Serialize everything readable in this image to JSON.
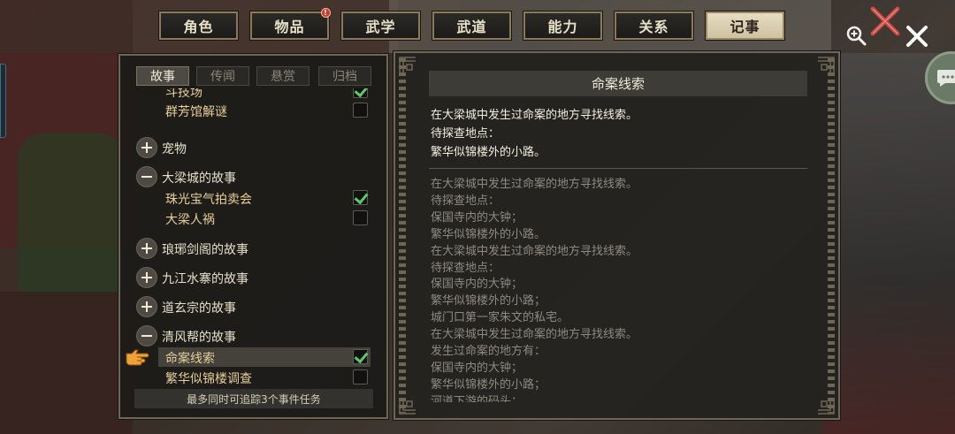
{
  "tabs": [
    {
      "label": "角色",
      "active": false
    },
    {
      "label": "物品",
      "active": false,
      "badge": "!"
    },
    {
      "label": "武学",
      "active": false
    },
    {
      "label": "武道",
      "active": false
    },
    {
      "label": "能力",
      "active": false
    },
    {
      "label": "关系",
      "active": false
    },
    {
      "label": "记事",
      "active": true
    }
  ],
  "subtabs": [
    {
      "label": "故事",
      "active": true
    },
    {
      "label": "传闻",
      "active": false
    },
    {
      "label": "悬赏",
      "active": false
    },
    {
      "label": "归档",
      "active": false
    }
  ],
  "list": {
    "items": [
      {
        "kind": "sub",
        "label": "斗技场",
        "checked": true
      },
      {
        "kind": "sub",
        "label": "群芳馆解谜",
        "checked": false
      },
      {
        "kind": "group",
        "label": "宠物",
        "expanded": false
      },
      {
        "kind": "group",
        "label": "大梁城的故事",
        "expanded": true
      },
      {
        "kind": "sub",
        "label": "珠光宝气拍卖会",
        "checked": true
      },
      {
        "kind": "sub",
        "label": "大梁人祸",
        "checked": false
      },
      {
        "kind": "group",
        "label": "琅琊剑阁的故事",
        "expanded": false
      },
      {
        "kind": "group",
        "label": "九江水寨的故事",
        "expanded": false
      },
      {
        "kind": "group",
        "label": "道玄宗的故事",
        "expanded": false
      },
      {
        "kind": "group",
        "label": "清风帮的故事",
        "expanded": true
      },
      {
        "kind": "sub",
        "label": "命案线索",
        "checked": true,
        "selected": true
      },
      {
        "kind": "sub",
        "label": "繁华似锦楼调查",
        "checked": false
      }
    ]
  },
  "footer": "最多同时可追踪3个事件任务",
  "detail": {
    "title": "命案线索",
    "current": [
      "在大梁城中发生过命案的地方寻找线索。",
      "待探查地点：",
      "繁华似锦楼外的小路。"
    ],
    "history": [
      "在大梁城中发生过命案的地方寻找线索。",
      "待探查地点：",
      "保国寺内的大钟；",
      "繁华似锦楼外的小路。",
      "在大梁城中发生过命案的地方寻找线索。",
      "待探查地点：",
      "保国寺内的大钟；",
      "繁华似锦楼外的小路；",
      "城门口第一家朱文的私宅。",
      "在大梁城中发生过命案的地方寻找线索。",
      "发生过命案的地方有：",
      "保国寺内的大钟；",
      "繁华似锦楼外的小路；",
      "河道下游的码头；"
    ]
  },
  "colors": {
    "accent_check": "#5fc86a",
    "tab_active_bg": "#e6dcc2",
    "badge": "#c63a2a"
  },
  "icons": [
    "zoom-in-icon",
    "crossed-swords-icon",
    "close-icon",
    "chat-bubble-icon",
    "pointing-hand-icon",
    "plus-icon",
    "minus-icon",
    "checkmark-icon"
  ]
}
